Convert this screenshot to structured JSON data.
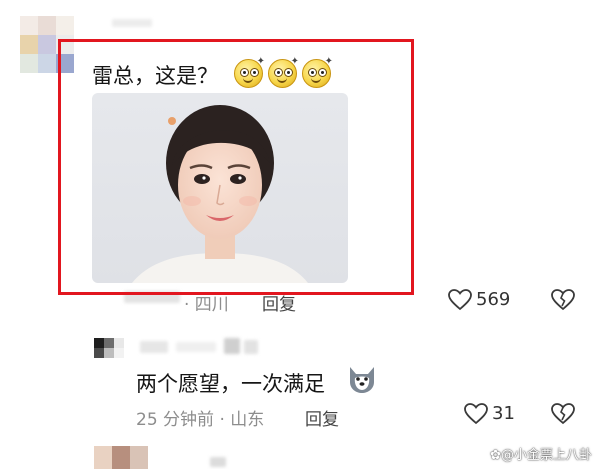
{
  "comment1": {
    "text": "雷总，这是？",
    "emoji_names": [
      "smirk-face-icon",
      "smirk-face-icon",
      "smirk-face-icon"
    ],
    "meta_location": "· 四川",
    "reply_label": "回复",
    "like_count": "569"
  },
  "comment2": {
    "text": "两个愿望，一次满足",
    "emoji_name": "husky-dog-icon",
    "meta": "25 分钟前 · 山东",
    "reply_label": "回复",
    "like_count": "31"
  },
  "watermark": "小金票上八卦",
  "colors": {
    "highlight_box": "#e2161f",
    "meta_gray": "#8d8d8d"
  }
}
